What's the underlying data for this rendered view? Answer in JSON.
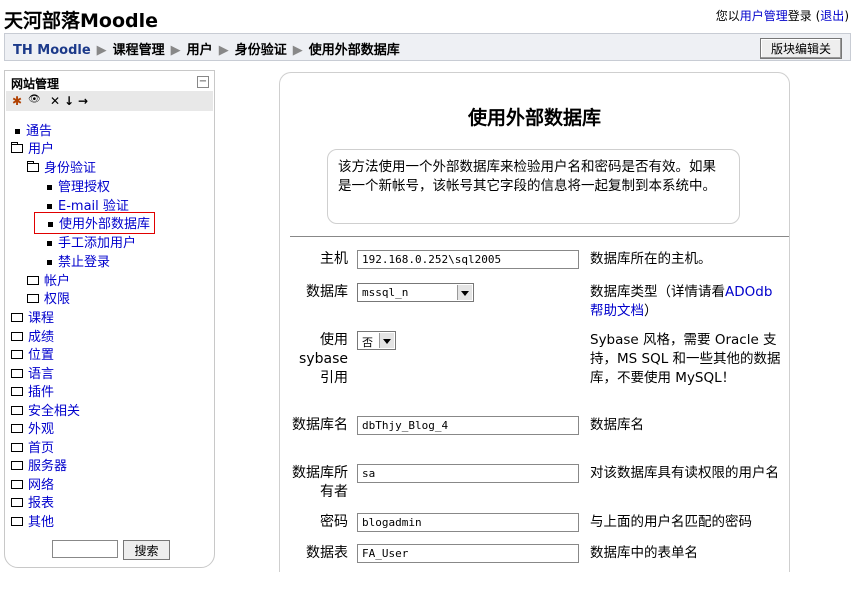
{
  "site": {
    "title": "天河部落Moodle"
  },
  "login": {
    "prefix": "您以",
    "user": "用户管理",
    "suffix": "登录 (",
    "logout": "退出",
    "close": ")"
  },
  "breadcrumb": [
    "TH Moodle",
    "课程管理",
    "用户",
    "身份验证",
    "使用外部数据库"
  ],
  "edit_button": "版块编辑关",
  "admin_block": {
    "title": "网站管理",
    "toggle": "−",
    "tools": [
      "✱",
      "👁",
      "✕",
      "↓",
      "→"
    ],
    "items": [
      {
        "label": "通告"
      },
      {
        "label": "用户"
      },
      {
        "label": "身份验证"
      },
      {
        "label": "管理授权"
      },
      {
        "label": "E-mail 验证"
      },
      {
        "label": "使用外部数据库"
      },
      {
        "label": "手工添加用户"
      },
      {
        "label": "禁止登录"
      },
      {
        "label": "帐户"
      },
      {
        "label": "权限"
      },
      {
        "label": "课程"
      },
      {
        "label": "成绩"
      },
      {
        "label": "位置"
      },
      {
        "label": "语言"
      },
      {
        "label": "插件"
      },
      {
        "label": "安全相关"
      },
      {
        "label": "外观"
      },
      {
        "label": "首页"
      },
      {
        "label": "服务器"
      },
      {
        "label": "网络"
      },
      {
        "label": "报表"
      },
      {
        "label": "其他"
      }
    ],
    "search_button": "搜索",
    "search_value": ""
  },
  "main": {
    "heading": "使用外部数据库",
    "intro": "该方法使用一个外部数据库来检验用户名和密码是否有效。如果是一个新帐号，该帐号其它字段的信息将一起复制到本系统中。",
    "fields": {
      "host": {
        "label": "主机",
        "value": "192.168.0.252\\sql2005",
        "desc": "数据库所在的主机。"
      },
      "type": {
        "label": "数据库",
        "value": "mssql_n",
        "desc_prefix": "数据库类型（详情请看",
        "desc_link": "ADOdb 帮助文档",
        "desc_suffix": "）"
      },
      "sybase": {
        "label": "使用 sybase 引用",
        "value": "否",
        "desc": "Sybase 风格，需要 Oracle 支持，MS SQL 和一些其他的数据库，不要使用 MySQL！"
      },
      "name": {
        "label": "数据库名",
        "value": "dbThjy_Blog_4",
        "desc": "数据库名"
      },
      "user": {
        "label": "数据库所有者",
        "value": "sa",
        "desc": "对该数据库具有读权限的用户名"
      },
      "pass": {
        "label": "密码",
        "value": "blogadmin",
        "desc": "与上面的用户名匹配的密码"
      },
      "table": {
        "label": "数据表",
        "value": "FA_User",
        "desc": "数据库中的表单名"
      }
    }
  }
}
